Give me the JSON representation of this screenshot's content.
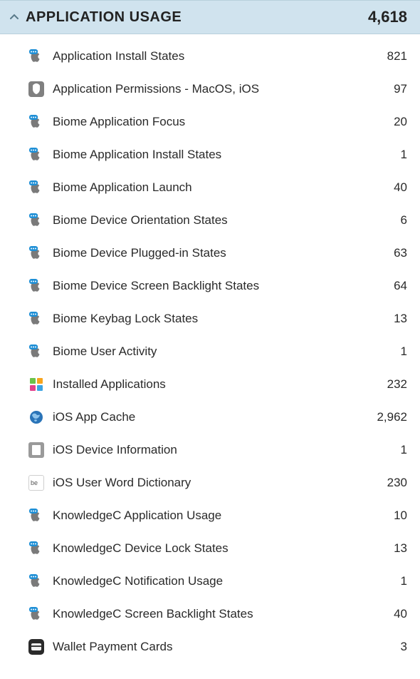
{
  "section": {
    "title": "APPLICATION USAGE",
    "count": "4,618",
    "caret_icon": "chevron-up"
  },
  "items": [
    {
      "icon": "apple-badge",
      "label": "Application Install States",
      "count": "821"
    },
    {
      "icon": "permissions",
      "label": "Application Permissions - MacOS, iOS",
      "count": "97"
    },
    {
      "icon": "apple-badge",
      "label": "Biome Application Focus",
      "count": "20"
    },
    {
      "icon": "apple-badge",
      "label": "Biome Application Install States",
      "count": "1"
    },
    {
      "icon": "apple-badge",
      "label": "Biome Application Launch",
      "count": "40"
    },
    {
      "icon": "apple-badge",
      "label": "Biome Device Orientation States",
      "count": "6"
    },
    {
      "icon": "apple-badge",
      "label": "Biome Device Plugged-in States",
      "count": "63"
    },
    {
      "icon": "apple-badge",
      "label": "Biome Device Screen Backlight States",
      "count": "64"
    },
    {
      "icon": "apple-badge",
      "label": "Biome Keybag Lock States",
      "count": "13"
    },
    {
      "icon": "apple-badge",
      "label": "Biome User Activity",
      "count": "1"
    },
    {
      "icon": "installed",
      "label": "Installed Applications",
      "count": "232"
    },
    {
      "icon": "globe",
      "label": "iOS App Cache",
      "count": "2,962"
    },
    {
      "icon": "device-info",
      "label": "iOS Device Information",
      "count": "1"
    },
    {
      "icon": "dictionary",
      "label": "iOS User Word Dictionary",
      "count": "230"
    },
    {
      "icon": "apple-badge",
      "label": "KnowledgeC Application Usage",
      "count": "10"
    },
    {
      "icon": "apple-badge",
      "label": "KnowledgeC Device Lock States",
      "count": "13"
    },
    {
      "icon": "apple-badge",
      "label": "KnowledgeC Notification Usage",
      "count": "1"
    },
    {
      "icon": "apple-badge",
      "label": "KnowledgeC Screen Backlight States",
      "count": "40"
    },
    {
      "icon": "wallet",
      "label": "Wallet Payment Cards",
      "count": "3"
    }
  ]
}
